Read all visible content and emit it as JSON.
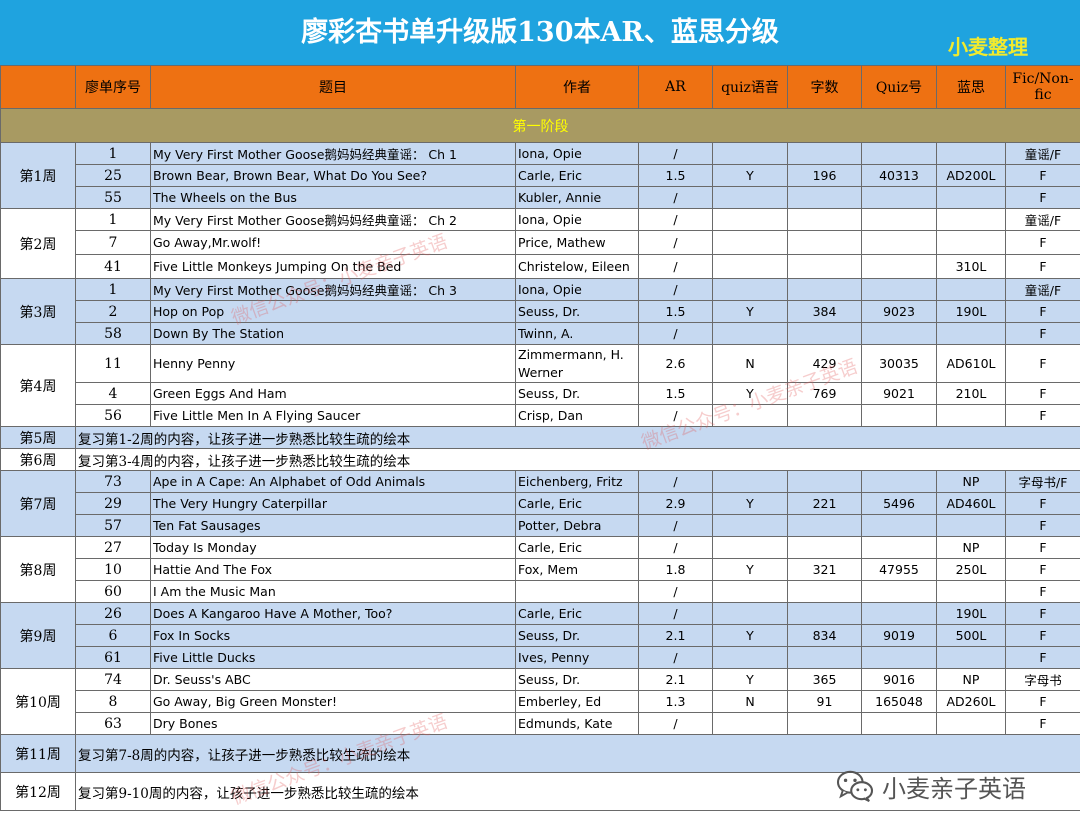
{
  "title": "廖彩杏书单升级版130本AR、蓝思分级",
  "credit": "小麦整理",
  "headers": [
    "",
    "廖单序号",
    "题目",
    "作者",
    "AR",
    "quiz语音",
    "字数",
    "Quiz号",
    "蓝思",
    "Fic/Non-fic"
  ],
  "stage": "第一阶段",
  "weeks": [
    {
      "week": "第1周",
      "shade": "blue",
      "rows": [
        {
          "no": "1",
          "title": "My Very First Mother Goose鹅妈妈经典童谣： Ch 1",
          "author": "Iona, Opie",
          "ar": "/",
          "quiz_voice": "",
          "words": "",
          "quiz_no": "",
          "lexile": "",
          "fic": "童谣/F"
        },
        {
          "no": "25",
          "title": "Brown Bear, Brown Bear, What Do You See?",
          "author": "Carle, Eric",
          "ar": "1.5",
          "quiz_voice": "Y",
          "words": "196",
          "quiz_no": "40313",
          "lexile": "AD200L",
          "fic": "F"
        },
        {
          "no": "55",
          "title": "The Wheels on the Bus",
          "author": "Kubler, Annie",
          "ar": "/",
          "quiz_voice": "",
          "words": "",
          "quiz_no": "",
          "lexile": "",
          "fic": "F"
        }
      ]
    },
    {
      "week": "第2周",
      "shade": "white",
      "rows": [
        {
          "no": "1",
          "title": "My Very First Mother Goose鹅妈妈经典童谣： Ch 2",
          "author": "Iona, Opie",
          "ar": "/",
          "quiz_voice": "",
          "words": "",
          "quiz_no": "",
          "lexile": "",
          "fic": "童谣/F"
        },
        {
          "no": "7",
          "title": "Go Away,Mr.wolf!",
          "author": "Price, Mathew",
          "ar": "/",
          "quiz_voice": "",
          "words": "",
          "quiz_no": "",
          "lexile": "",
          "fic": "F"
        },
        {
          "no": "41",
          "title": "Five Little Monkeys Jumping On the Bed",
          "author": "Christelow, Eileen",
          "ar": "/",
          "quiz_voice": "",
          "words": "",
          "quiz_no": "",
          "lexile": "310L",
          "fic": "F"
        }
      ]
    },
    {
      "week": "第3周",
      "shade": "blue",
      "rows": [
        {
          "no": "1",
          "title": "My Very First Mother Goose鹅妈妈经典童谣： Ch 3",
          "author": "Iona, Opie",
          "ar": "/",
          "quiz_voice": "",
          "words": "",
          "quiz_no": "",
          "lexile": "",
          "fic": "童谣/F"
        },
        {
          "no": "2",
          "title": "Hop on Pop",
          "author": "Seuss, Dr.",
          "ar": "1.5",
          "quiz_voice": "Y",
          "words": "384",
          "quiz_no": "9023",
          "lexile": "190L",
          "fic": "F"
        },
        {
          "no": "58",
          "title": "Down By The Station",
          "author": "Twinn, A.",
          "ar": "/",
          "quiz_voice": "",
          "words": "",
          "quiz_no": "",
          "lexile": "",
          "fic": "F"
        }
      ]
    },
    {
      "week": "第4周",
      "shade": "white",
      "rows": [
        {
          "no": "11",
          "title": "Henny Penny",
          "author": "Zimmermann, H. Werner",
          "ar": "2.6",
          "quiz_voice": "N",
          "words": "429",
          "quiz_no": "30035",
          "lexile": "AD610L",
          "fic": "F"
        },
        {
          "no": "4",
          "title": "Green Eggs And Ham",
          "author": "Seuss, Dr.",
          "ar": "1.5",
          "quiz_voice": "Y",
          "words": "769",
          "quiz_no": "9021",
          "lexile": "210L",
          "fic": "F"
        },
        {
          "no": "56",
          "title": "Five Little Men In A Flying Saucer",
          "author": "Crisp, Dan",
          "ar": "/",
          "quiz_voice": "",
          "words": "",
          "quiz_no": "",
          "lexile": "",
          "fic": "F"
        }
      ]
    },
    {
      "week": "第5周",
      "shade": "blue",
      "review": "复习第1-2周的内容，让孩子进一步熟悉比较生疏的绘本"
    },
    {
      "week": "第6周",
      "shade": "white",
      "review": "复习第3-4周的内容，让孩子进一步熟悉比较生疏的绘本"
    },
    {
      "week": "第7周",
      "shade": "blue",
      "rows": [
        {
          "no": "73",
          "title": "Ape in A Cape: An Alphabet of Odd Animals",
          "author": "Eichenberg, Fritz",
          "ar": "/",
          "quiz_voice": "",
          "words": "",
          "quiz_no": "",
          "lexile": "NP",
          "fic": "字母书/F"
        },
        {
          "no": "29",
          "title": "The Very Hungry Caterpillar",
          "author": "Carle, Eric",
          "ar": "2.9",
          "quiz_voice": "Y",
          "words": "221",
          "quiz_no": "5496",
          "lexile": "AD460L",
          "fic": "F"
        },
        {
          "no": "57",
          "title": "Ten Fat Sausages",
          "author": "Potter, Debra",
          "ar": "/",
          "quiz_voice": "",
          "words": "",
          "quiz_no": "",
          "lexile": "",
          "fic": "F"
        }
      ]
    },
    {
      "week": "第8周",
      "shade": "white",
      "rows": [
        {
          "no": "27",
          "title": "Today Is Monday",
          "author": "Carle, Eric",
          "ar": "/",
          "quiz_voice": "",
          "words": "",
          "quiz_no": "",
          "lexile": "NP",
          "fic": "F"
        },
        {
          "no": "10",
          "title": "Hattie And The Fox",
          "author": "Fox, Mem",
          "ar": "1.8",
          "quiz_voice": "Y",
          "words": "321",
          "quiz_no": "47955",
          "lexile": "250L",
          "fic": "F"
        },
        {
          "no": "60",
          "title": "I Am the Music Man",
          "author": "",
          "ar": "/",
          "quiz_voice": "",
          "words": "",
          "quiz_no": "",
          "lexile": "",
          "fic": "F"
        }
      ]
    },
    {
      "week": "第9周",
      "shade": "blue",
      "rows": [
        {
          "no": "26",
          "title": "Does A Kangaroo Have A Mother, Too?",
          "author": "Carle, Eric",
          "ar": "/",
          "quiz_voice": "",
          "words": "",
          "quiz_no": "",
          "lexile": "190L",
          "fic": "F"
        },
        {
          "no": "6",
          "title": "Fox In Socks",
          "author": "Seuss, Dr.",
          "ar": "2.1",
          "quiz_voice": "Y",
          "words": "834",
          "quiz_no": "9019",
          "lexile": "500L",
          "fic": "F"
        },
        {
          "no": "61",
          "title": "Five Little Ducks",
          "author": "Ives, Penny",
          "ar": "/",
          "quiz_voice": "",
          "words": "",
          "quiz_no": "",
          "lexile": "",
          "fic": "F"
        }
      ]
    },
    {
      "week": "第10周",
      "shade": "white",
      "rows": [
        {
          "no": "74",
          "title": "Dr. Seuss's ABC",
          "author": "Seuss, Dr.",
          "ar": "2.1",
          "quiz_voice": "Y",
          "words": "365",
          "quiz_no": "9016",
          "lexile": "NP",
          "fic": "字母书"
        },
        {
          "no": "8",
          "title": "Go Away, Big Green Monster!",
          "author": "Emberley, Ed",
          "ar": "1.3",
          "quiz_voice": "N",
          "words": "91",
          "quiz_no": "165048",
          "lexile": "AD260L",
          "fic": "F"
        },
        {
          "no": "63",
          "title": "Dry Bones",
          "author": "Edmunds, Kate",
          "ar": "/",
          "quiz_voice": "",
          "words": "",
          "quiz_no": "",
          "lexile": "",
          "fic": "F"
        }
      ]
    },
    {
      "week": "第11周",
      "shade": "blue",
      "review": "复习第7-8周的内容，让孩子进一步熟悉比较生疏的绘本"
    },
    {
      "week": "第12周",
      "shade": "white",
      "review": "复习第9-10周的内容，让孩子进一步熟悉比较生疏的绘本"
    }
  ],
  "watermarks": [
    "微信公众号：小麦亲子英语",
    "微信公众号：小麦亲子英语",
    "微信公众号：小麦亲子英语"
  ],
  "brand": {
    "text": "小麦亲子英语",
    "icon": "wechat-icon"
  },
  "colors": {
    "title_bg": "#1fa3df",
    "header_bg": "#ee7112",
    "stage_bg": "#a89a62",
    "row_blue": "#c6d9f1",
    "credit": "#f2ea2e"
  }
}
